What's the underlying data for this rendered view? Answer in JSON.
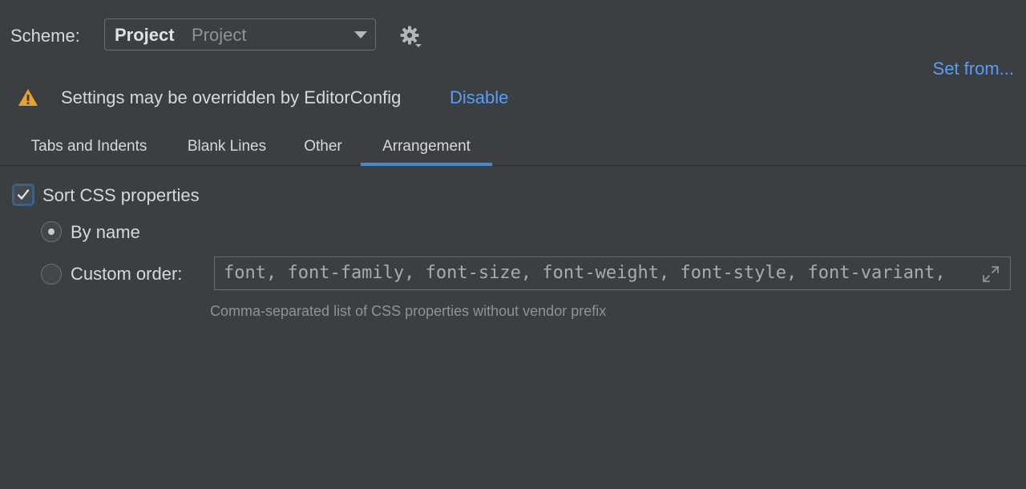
{
  "scheme": {
    "label": "Scheme:",
    "selected_name": "Project",
    "selected_kind": "Project",
    "settings_icon": "gear-icon",
    "set_from_label": "Set from..."
  },
  "warning": {
    "icon": "warning-icon",
    "text": "Settings may be overridden by EditorConfig",
    "link": "Disable"
  },
  "tabs": [
    {
      "label": "Tabs and Indents",
      "active": false
    },
    {
      "label": "Blank Lines",
      "active": false
    },
    {
      "label": "Other",
      "active": false
    },
    {
      "label": "Arrangement",
      "active": true
    }
  ],
  "arrangement": {
    "sort_label": "Sort CSS properties",
    "sort_checked": true,
    "by_name_label": "By name",
    "by_name_selected": true,
    "custom_order_label": "Custom order:",
    "custom_order_selected": false,
    "custom_order_value": "font, font-family, font-size, font-weight, font-style, font-variant,",
    "custom_order_hint": "Comma-separated list of CSS properties without vendor prefix",
    "expand_icon": "expand-icon"
  },
  "colors": {
    "background": "#3c3f41",
    "link": "#589df6",
    "tab_underline": "#4a88c7",
    "warning": "#e6a230"
  }
}
